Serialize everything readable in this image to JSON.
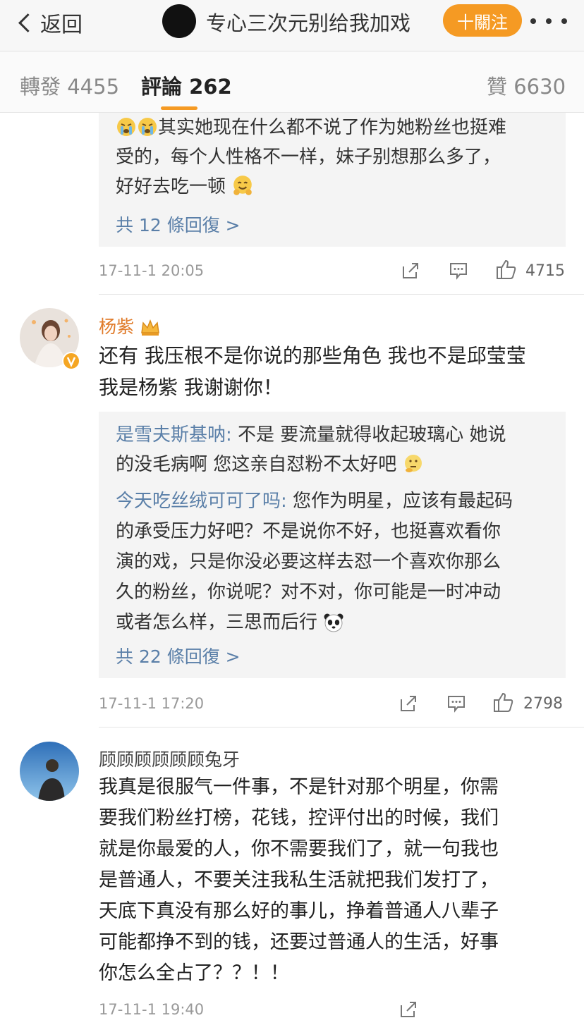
{
  "nav": {
    "back_label": "返回",
    "title": "专心三次元别给我加戏",
    "follow_label": "十關注"
  },
  "tabs": {
    "reposts": "轉發 4455",
    "comments": "評論 262",
    "likes": "贊 6630"
  },
  "comment1": {
    "reply_lines": [
      "其实她现在什么都不说了作为她粉丝也挺难",
      "受的，每个人性格不一样，妹子别想那么多了，",
      "好好去吃一顿"
    ],
    "more_replies": "共 12 條回復 >",
    "time": "17-11-1 20:05",
    "likes": "4715"
  },
  "comment2": {
    "username": "杨紫",
    "text_lines": [
      "还有 我压根不是你说的那些角色 我也不是邱莹莹",
      "我是杨紫 我谢谢你！"
    ],
    "reply1_name": "是雪夫斯基呐:",
    "reply1_lines": [
      " 不是 要流量就得收起玻璃心 她说",
      "的没毛病啊 您这亲自怼粉不太好吧"
    ],
    "reply2_name": "今天吃丝绒可可了吗:",
    "reply2_lines": [
      " 您作为明星，应该有最起码",
      "的承受压力好吧？不是说你不好，也挺喜欢看你",
      "演的戏，只是你没必要这样去怼一个喜欢你那么",
      "久的粉丝，你说呢？对不对，你可能是一时冲动",
      "或者怎么样，三思而后行"
    ],
    "more_replies": "共 22 條回復 >",
    "time": "17-11-1 17:20",
    "likes": "2798"
  },
  "comment3": {
    "username": "顾顾顾顾顾顾兔牙",
    "text_lines": [
      "我真是很服气一件事，不是针对那个明星，你需",
      "要我们粉丝打榜，花钱，控评付出的时候，我们",
      "就是你最爱的人，你不需要我们了，就一句我也",
      "是普通人，不要关注我私生活就把我们发打了，",
      "天底下真没有那么好的事儿，挣着普通人八辈子",
      "可能都挣不到的钱，还要过普通人的生活，好事",
      "你怎么全占了？？！！"
    ],
    "time": "17-11-1 19:40"
  },
  "colors": {
    "accent_orange": "#f59a23",
    "link_blue": "#5a7fa8",
    "vip_name_orange": "#e07b2a"
  }
}
